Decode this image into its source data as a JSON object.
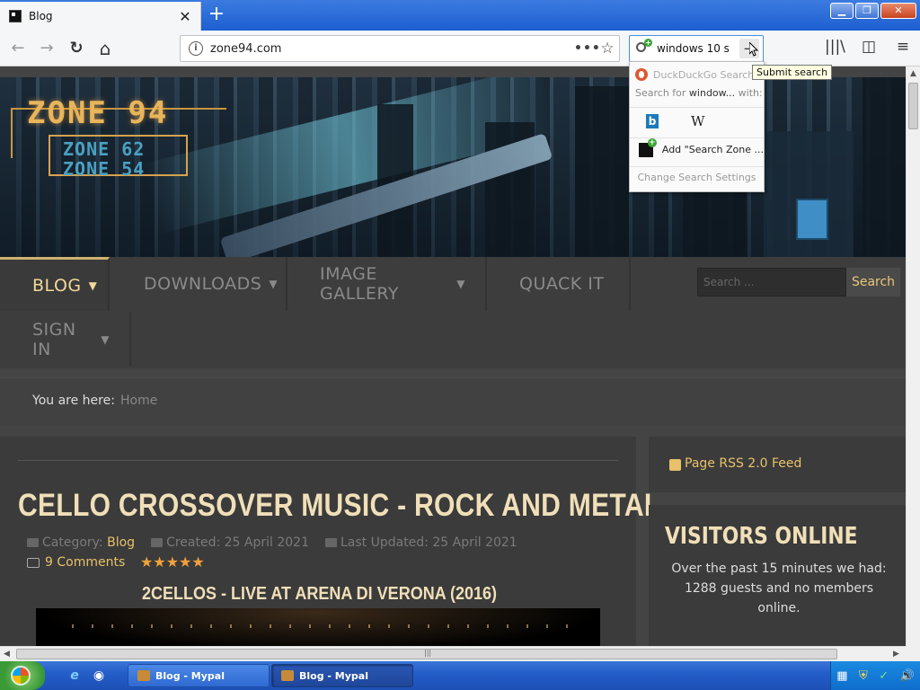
{
  "browser": {
    "tab": {
      "title": "Blog",
      "close_symbol": "✕",
      "new_tab_symbol": "+"
    },
    "window_controls": {
      "minimize": "▁",
      "maximize": "❐",
      "close": "✕"
    },
    "url": "zone94.com",
    "url_actions_symbol": "•••",
    "bookmark_symbol": "☆",
    "search_value": "windows 10 s",
    "search_go_symbol": "→",
    "nav_symbols": {
      "back": "←",
      "forward": "→",
      "reload": "↻",
      "home": "⌂"
    },
    "tool_symbols": {
      "library": "|||\\",
      "sidebar": "◫",
      "menu": "≡"
    }
  },
  "search_dropdown": {
    "engine_label": "DuckDuckGo Search",
    "search_for_prefix": "Search for ",
    "search_for_term": "window...",
    "search_for_suffix": " with:",
    "bing_label": "b",
    "wikipedia_label": "W",
    "add_label": "Add \"Search Zone ...",
    "settings_label": "Change Search Settings",
    "tooltip": "Submit search"
  },
  "site": {
    "logo_main": "ZONE 94",
    "logo_sub1": "ZONE 62",
    "logo_sub2": "ZONE 54",
    "menu": [
      {
        "label": "BLOG",
        "caret": "▼"
      },
      {
        "label": "DOWNLOADS",
        "caret": "▼"
      },
      {
        "label": "IMAGE GALLERY",
        "caret": "▼"
      },
      {
        "label": "QUACK IT",
        "caret": ""
      },
      {
        "label": "SIGN IN",
        "caret": "▼"
      }
    ],
    "nav_search_placeholder": "Search ...",
    "nav_search_button": "Search",
    "breadcrumb_label": "You are here:",
    "breadcrumb_home": "Home"
  },
  "article": {
    "title": "CELLO CROSSOVER MUSIC - ROCK AND METAL",
    "category_label": "Category:",
    "category_value": "Blog",
    "created": "Created: 25 April 2021",
    "updated": "Last Updated: 25 April 2021",
    "comments": "9 Comments",
    "rating": "★★★★★",
    "subheading": "2CELLOS - LIVE AT ARENA DI VERONA (2016)"
  },
  "sidebar": {
    "rss": "Page RSS 2.0 Feed",
    "visitors_title": "VISITORS ONLINE",
    "visitors_text": "Over the past 15 minutes we had: 1288 guests and no members online."
  },
  "taskbar": {
    "tasks": [
      {
        "label": "Blog - Mypal"
      },
      {
        "label": "Blog - Mypal"
      }
    ],
    "ql_ie": "e",
    "ql_other": "◉",
    "tray_icons": [
      "▦",
      "⛨",
      "✓",
      "🔊"
    ]
  },
  "colors": {
    "accent_gold": "#f0dfb8",
    "link": "#e8c16a",
    "page_bg": "#3a3a3a",
    "taskbar_blue": "#245ec8"
  }
}
